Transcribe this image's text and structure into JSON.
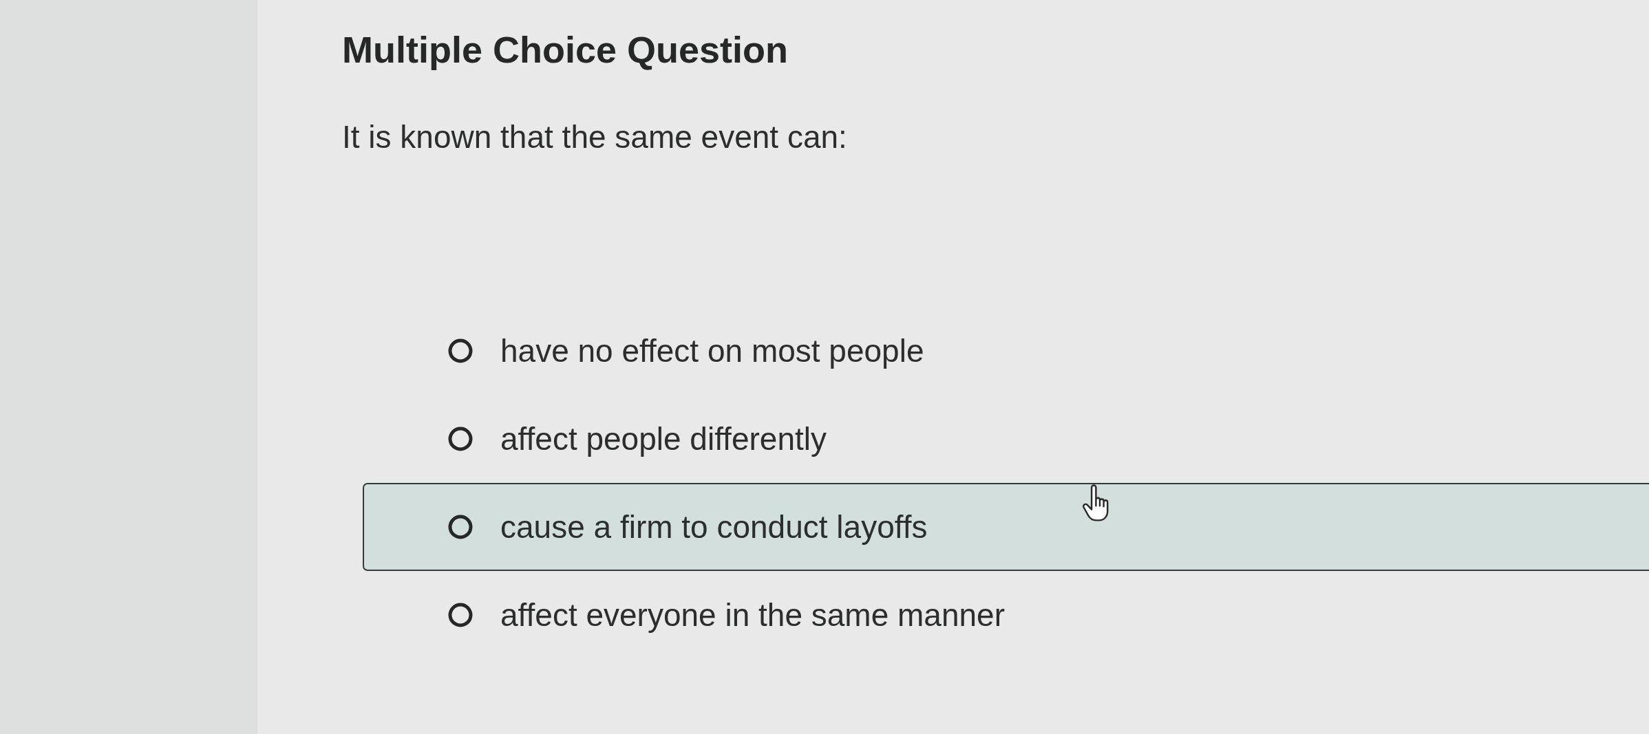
{
  "heading": "Multiple Choice Question",
  "question": "It is known that the same event can:",
  "options": [
    {
      "label": "have no effect on most people",
      "selected": false,
      "hovered": false
    },
    {
      "label": "affect people differently",
      "selected": false,
      "hovered": false
    },
    {
      "label": "cause a firm to conduct layoffs",
      "selected": false,
      "hovered": true
    },
    {
      "label": "affect everyone in the same manner",
      "selected": false,
      "hovered": false
    }
  ]
}
